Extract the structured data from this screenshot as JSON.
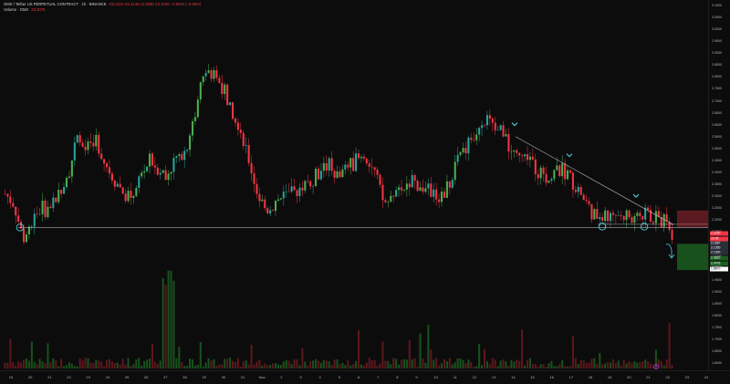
{
  "legend": {
    "symbol_line": "GMX / Tether US PERPETUAL CONTRACT · 1h · BINANCE",
    "ohlc": "O2.2110 H2.2140 L2.2090 C2.2100 −0.0010 (−0.05%)",
    "volume_label": "Volume · GMX",
    "volume_value": "23.307K"
  },
  "price_axis": {
    "ticks": [
      "3.1000",
      "3.0500",
      "3.0000",
      "2.9500",
      "2.9000",
      "2.8500",
      "2.8000",
      "2.7500",
      "2.7000",
      "2.6500",
      "2.6000",
      "2.5500",
      "2.5000",
      "2.4500",
      "2.4000",
      "2.3500",
      "2.3000",
      "2.2500",
      "2.2000",
      "2.1500",
      "2.1000",
      "2.0500",
      "2.0000",
      "1.9500",
      "1.9000",
      "1.8500",
      "1.8000",
      "1.7500",
      "1.7000",
      "1.6500",
      "1.6000"
    ]
  },
  "price_badges": [
    {
      "label": "2.2230",
      "color": "#f23645"
    },
    {
      "label": "15:45",
      "color": "#f23645"
    },
    {
      "label": "2.1687",
      "color": "#2a2e39"
    },
    {
      "label": "2.1350",
      "color": "#2a2e39"
    },
    {
      "label": "2.1300",
      "color": "#2a2e39"
    },
    {
      "label": "2.0820",
      "color": "#1b5e20"
    },
    {
      "label": "2.0478",
      "color": "#1b5e20"
    },
    {
      "label": "1.8870",
      "color": "#ffffff"
    }
  ],
  "time_axis": {
    "ticks": [
      "19",
      "20",
      "21",
      "22",
      "23",
      "24",
      "25",
      "26",
      "27",
      "28",
      "29",
      "30",
      "31",
      "Nov",
      "2",
      "3",
      "4",
      "5",
      "6",
      "7",
      "8",
      "9",
      "10",
      "11",
      "12",
      "13",
      "14",
      "15",
      "16",
      "17",
      "18",
      "19",
      "20",
      "21",
      "22",
      "23",
      "24"
    ]
  },
  "colors": {
    "up": "#26a69a",
    "up_alt": "#4caf50",
    "down": "#f23645",
    "trendline": "#b2b5be",
    "marker": "#4dd0e1",
    "support": "#d1d4dc"
  },
  "chart_data": {
    "type": "candlestick",
    "title": "GMX / Tether US PERPETUAL CONTRACT · 1h · BINANCE",
    "x_range": [
      "19",
      "24"
    ],
    "ylim": [
      1.6,
      3.1
    ],
    "close_series": [
      2.31,
      2.27,
      2.12,
      2.2,
      2.25,
      2.24,
      2.32,
      2.4,
      2.53,
      2.49,
      2.55,
      2.45,
      2.38,
      2.32,
      2.3,
      2.38,
      2.45,
      2.42,
      2.4,
      2.46,
      2.49,
      2.63,
      2.82,
      2.81,
      2.77,
      2.68,
      2.6,
      2.46,
      2.31,
      2.24,
      2.28,
      2.3,
      2.31,
      2.35,
      2.37,
      2.41,
      2.43,
      2.38,
      2.42,
      2.45,
      2.48,
      2.4,
      2.27,
      2.28,
      2.33,
      2.36,
      2.35,
      2.32,
      2.3,
      2.33,
      2.43,
      2.5,
      2.56,
      2.63,
      2.6,
      2.57,
      2.5,
      2.44,
      2.47,
      2.41,
      2.38,
      2.4,
      2.41,
      2.36,
      2.3,
      2.24,
      2.2,
      2.22,
      2.23,
      2.22,
      2.21,
      2.22,
      2.21,
      2.2,
      2.15
    ],
    "trendline_start": 2.55,
    "trendline_end": 2.18,
    "support_level": 2.1687,
    "volume_peak": "23.307K"
  }
}
